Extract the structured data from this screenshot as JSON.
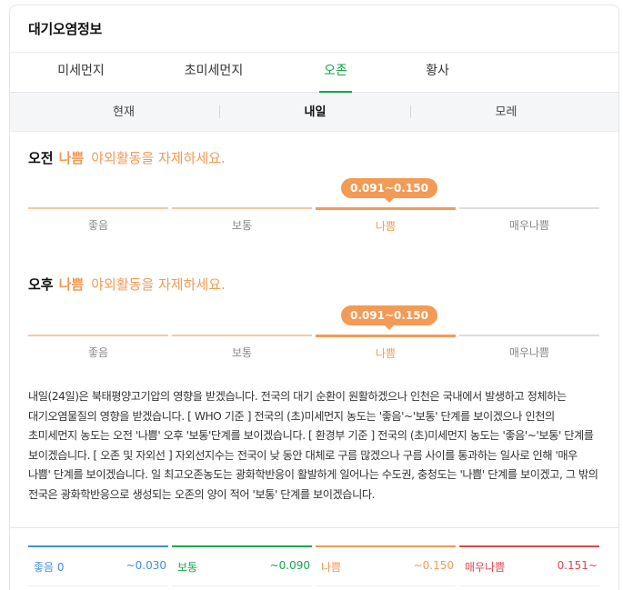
{
  "header": {
    "title": "대기오염정보"
  },
  "tabs": [
    {
      "label": "미세먼지",
      "active": false
    },
    {
      "label": "초미세먼지",
      "active": false
    },
    {
      "label": "오존",
      "active": true
    },
    {
      "label": "황사",
      "active": false
    }
  ],
  "subtabs": [
    {
      "label": "현재",
      "active": false
    },
    {
      "label": "내일",
      "active": true
    },
    {
      "label": "모레",
      "active": false
    }
  ],
  "morning": {
    "period": "오전",
    "grade": "나쁨",
    "message": "야외활동을 자제하세요.",
    "range": "0.091~0.150",
    "scale": [
      "좋음",
      "보통",
      "나쁨",
      "매우나쁨"
    ]
  },
  "afternoon": {
    "period": "오후",
    "grade": "나쁨",
    "message": "야외활동을 자제하세요.",
    "range": "0.091~0.150",
    "scale": [
      "좋음",
      "보통",
      "나쁨",
      "매우나쁨"
    ]
  },
  "description": "내일(24일)은 북태평양고기압의 영향을 받겠습니다. 전국의 대기 순환이 원활하겠으나 인천은 국내에서 발생하고 정체하는 대기오염물질의 영향을 받겠습니다. [ WHO 기준 ] 전국의 (초)미세먼지 농도는 '좋음'~'보통' 단계를 보이겠으나 인천의 초미세먼지 농도는 오전 '나쁨' 오후 '보통'단계를 보이겠습니다. [ 환경부 기준 ] 전국의 (초)미세먼지 농도는 '좋음'~'보통' 단계를 보이겠습니다. [ 오존 및 자외선 ] 자외선지수는 전국이 낮 동안 대체로 구름 많겠으나 구름 사이를 통과하는 일사로 인해 '매우 나쁨' 단계를 보이겠습니다. 일 최고오존농도는 광화학반응이 활발하게 일어나는 수도권, 충청도는 '나쁨' 단계를 보이겠고, 그 밖의 전국은 광화학반응으로 생성되는 오존의 양이 적어 '보통' 단계를 보이겠습니다.",
  "legend": [
    {
      "name": "좋음 0",
      "range": "~0.030",
      "color": "#3f8fe0"
    },
    {
      "name": "보통",
      "range": "~0.090",
      "color": "#16a64b"
    },
    {
      "name": "나쁨",
      "range": "~0.150",
      "color": "#f39a55"
    },
    {
      "name": "매우나쁨",
      "range": "0.151~",
      "color": "#e0474c"
    }
  ]
}
